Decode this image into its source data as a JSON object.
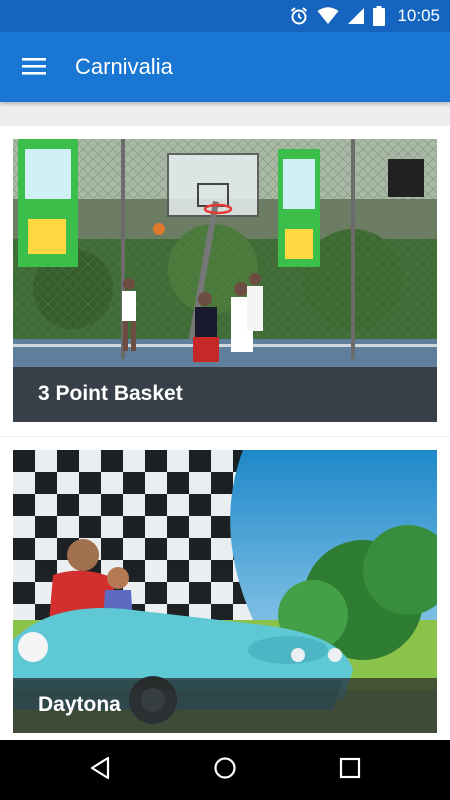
{
  "status_bar": {
    "time": "10:05",
    "icons": [
      "alarm-icon",
      "wifi-icon",
      "signal-icon",
      "battery-icon"
    ]
  },
  "app_bar": {
    "title": "Carnivalia",
    "menu_icon": "hamburger-menu-icon"
  },
  "cards": [
    {
      "title": "3 Point Basket",
      "image": "basketball-court-photo"
    },
    {
      "title": "Daytona",
      "image": "bumper-car-photo"
    }
  ],
  "nav_bar": {
    "buttons": [
      "back-icon",
      "home-icon",
      "recents-icon"
    ]
  },
  "colors": {
    "status_bar": "#1565c0",
    "app_bar": "#1976d2",
    "background": "#eeeeee",
    "card": "#ffffff",
    "nav_bar": "#000000"
  }
}
